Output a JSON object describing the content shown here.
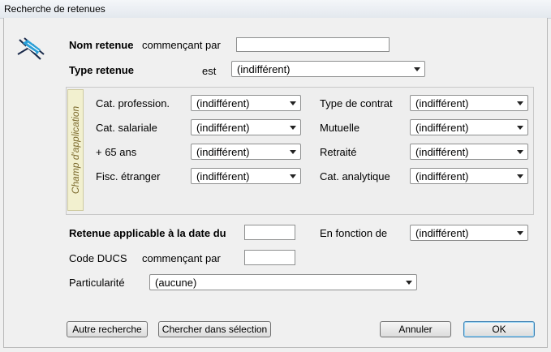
{
  "window": {
    "title": "Recherche de retenues"
  },
  "top": {
    "nom_label": "Nom retenue",
    "nom_suffix": "commençant par",
    "type_label": "Type retenue",
    "type_est": "est",
    "type_value": "(indifférent)"
  },
  "group": {
    "tab_label": "Champ d'application",
    "fields": [
      {
        "label": "Cat. profession.",
        "value": "(indifférent)"
      },
      {
        "label": "Type de contrat",
        "value": "(indifférent)"
      },
      {
        "label": "Cat. salariale",
        "value": "(indifférent)"
      },
      {
        "label": "Mutuelle",
        "value": "(indifférent)"
      },
      {
        "label": "+ 65 ans",
        "value": "(indifférent)"
      },
      {
        "label": "Retraité",
        "value": "(indifférent)"
      },
      {
        "label": "Fisc. étranger",
        "value": "(indifférent)"
      },
      {
        "label": "Cat. analytique",
        "value": "(indifférent)"
      }
    ]
  },
  "bottom": {
    "date_label": "Retenue applicable à la date du",
    "fonction_label": "En fonction de",
    "fonction_value": "(indifférent)",
    "ducs_label": "Code DUCS",
    "ducs_suffix": "commençant par",
    "particularite_label": "Particularité",
    "particularite_value": "(aucune)"
  },
  "buttons": {
    "autre": "Autre recherche",
    "chercher": "Chercher dans sélection",
    "annuler": "Annuler",
    "ok": "OK"
  }
}
